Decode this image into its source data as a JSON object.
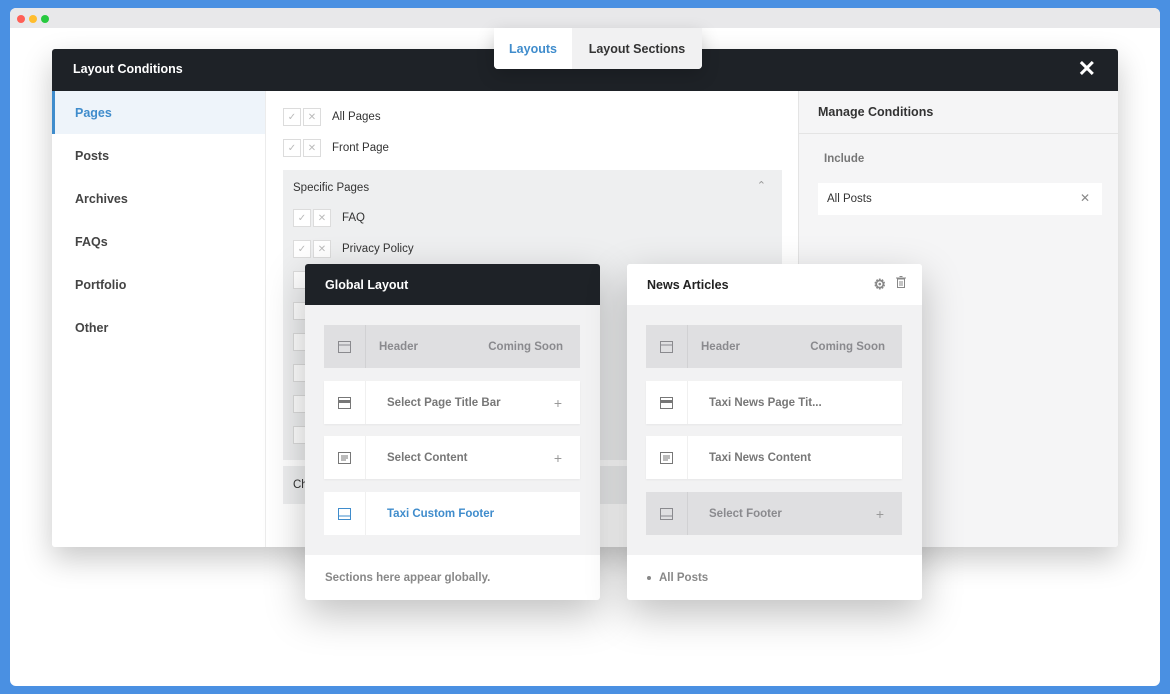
{
  "tabs": {
    "active": "Layouts",
    "inactive": "Layout Sections"
  },
  "modal": {
    "title": "Layout Conditions",
    "sidebar": [
      "Pages",
      "Posts",
      "Archives",
      "FAQs",
      "Portfolio",
      "Other"
    ],
    "conditions": [
      "All Pages",
      "Front Page"
    ],
    "specific": {
      "title": "Specific Pages",
      "items": [
        "FAQ",
        "Privacy Policy"
      ]
    },
    "next_group_label": "Ch",
    "manage": {
      "title": "Manage Conditions",
      "include_label": "Include",
      "include_item": "All Posts"
    }
  },
  "global_card": {
    "title": "Global Layout",
    "header_label": "Header",
    "header_status": "Coming Soon",
    "title_bar": "Select Page Title Bar",
    "content": "Select Content",
    "footer": "Taxi Custom Footer",
    "footer_note": "Sections here appear globally."
  },
  "news_card": {
    "title": "News Articles",
    "header_label": "Header",
    "header_status": "Coming Soon",
    "title_bar": "Taxi News Page Tit...",
    "content": "Taxi News Content",
    "footer": "Select Footer",
    "condition": "All Posts"
  },
  "colors": {
    "accent": "#3f8ccc",
    "dark": "#1e2227",
    "background": "#4a90e2"
  }
}
